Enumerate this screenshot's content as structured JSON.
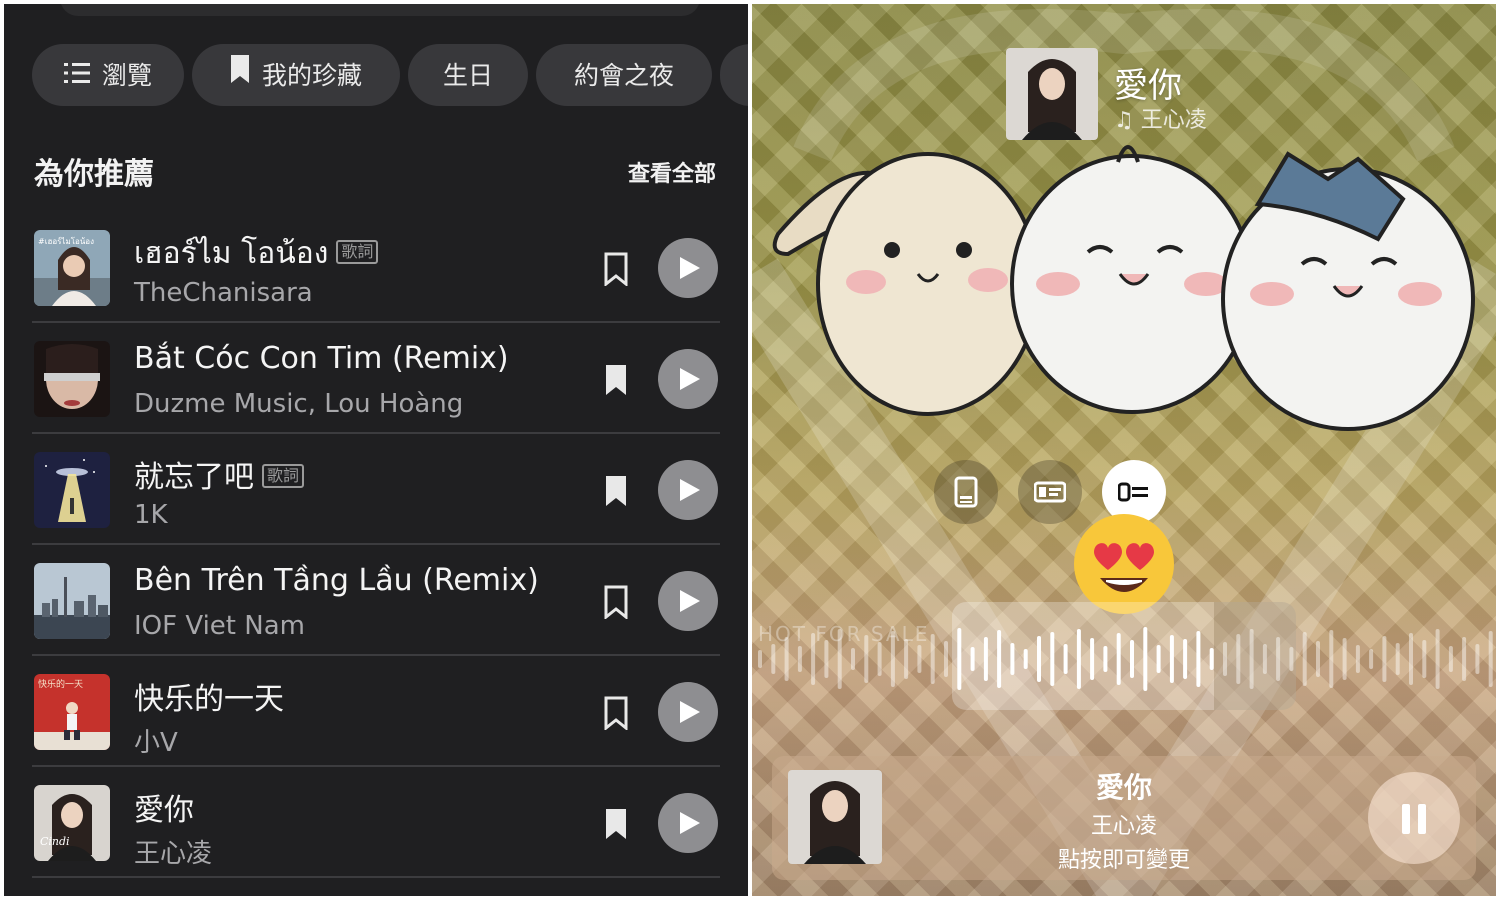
{
  "browse": {
    "chips": [
      {
        "label": "瀏覽",
        "icon": "list-icon"
      },
      {
        "label": "我的珍藏",
        "icon": "bookmark-icon"
      },
      {
        "label": "生日",
        "icon": ""
      },
      {
        "label": "約會之夜",
        "icon": ""
      }
    ],
    "section_title": "為你推薦",
    "see_all": "查看全部",
    "lyrics_badge": "歌詞",
    "songs": [
      {
        "title": "เฮอร์ไม โอน้อง",
        "artist": "TheChanisara",
        "lyrics": true,
        "bookmarked": false,
        "cover_text": "#เฮอร์ไมโอน้อง"
      },
      {
        "title": "Bắt Cóc Con Tim (Remix)",
        "artist": "Duzme Music, Lou Hoàng",
        "lyrics": false,
        "bookmarked": true,
        "cover_text": ""
      },
      {
        "title": "就忘了吧",
        "artist": "1K",
        "lyrics": true,
        "bookmarked": true,
        "cover_text": ""
      },
      {
        "title": "Bên Trên Tầng Lầu (Remix)",
        "artist": "IOF Viet Nam",
        "lyrics": false,
        "bookmarked": false,
        "cover_text": ""
      },
      {
        "title": "快乐的一天",
        "artist": "小V",
        "lyrics": false,
        "bookmarked": false,
        "cover_text": "快乐的一天"
      },
      {
        "title": "愛你",
        "artist": "王心凌",
        "lyrics": false,
        "bookmarked": true,
        "cover_text": "Cindi"
      }
    ]
  },
  "story": {
    "sticker": {
      "title": "愛你",
      "artist_prefix": "♫",
      "artist": "王心凌"
    },
    "style_buttons": [
      {
        "icon": "card-style-icon",
        "active": false
      },
      {
        "icon": "compact-style-icon",
        "active": false
      },
      {
        "icon": "lyrics-style-icon",
        "active": true
      }
    ],
    "emoji": "heart-eyes-emoji",
    "ticker": "HOT FOR SALE",
    "player": {
      "title": "愛你",
      "artist": "王心凌",
      "hint": "點按即可變更",
      "state": "playing"
    },
    "colors": {
      "panel_bg": "#1f1f21",
      "chip_bg": "#38383b",
      "play_bg": "#8e8e91"
    }
  }
}
